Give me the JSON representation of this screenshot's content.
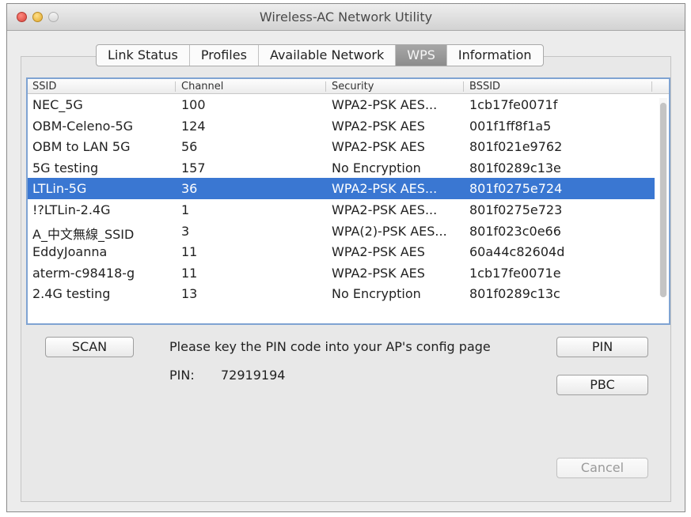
{
  "window": {
    "title": "Wireless-AC Network Utility"
  },
  "tabs": [
    {
      "label": "Link Status",
      "active": false
    },
    {
      "label": "Profiles",
      "active": false
    },
    {
      "label": "Available Network",
      "active": false
    },
    {
      "label": "WPS",
      "active": true
    },
    {
      "label": "Information",
      "active": false
    }
  ],
  "network_list": {
    "columns": [
      "SSID",
      "Channel",
      "Security",
      "BSSID"
    ],
    "rows": [
      {
        "ssid": "NEC_5G",
        "channel": "100",
        "security": "WPA2-PSK AES...",
        "bssid": "1cb17fe0071f"
      },
      {
        "ssid": "OBM-Celeno-5G",
        "channel": "124",
        "security": "WPA2-PSK AES",
        "bssid": "001f1ff8f1a5"
      },
      {
        "ssid": "OBM to LAN 5G",
        "channel": "56",
        "security": "WPA2-PSK AES",
        "bssid": "801f021e9762"
      },
      {
        "ssid": "5G testing",
        "channel": "157",
        "security": "No Encryption",
        "bssid": "801f0289c13e"
      },
      {
        "ssid": "LTLin-5G",
        "channel": "36",
        "security": "WPA2-PSK AES...",
        "bssid": "801f0275e724",
        "selected": true
      },
      {
        "ssid": "!?LTLin-2.4G",
        "channel": "1",
        "security": "WPA2-PSK AES...",
        "bssid": "801f0275e723"
      },
      {
        "ssid": "A_中文無線_SSID",
        "channel": "3",
        "security": "WPA(2)-PSK AES...",
        "bssid": "801f023c0e66"
      },
      {
        "ssid": "EddyJoanna",
        "channel": "11",
        "security": "WPA2-PSK AES",
        "bssid": "60a44c82604d"
      },
      {
        "ssid": "aterm-c98418-g",
        "channel": "11",
        "security": "WPA2-PSK AES",
        "bssid": "1cb17fe0071e"
      },
      {
        "ssid": "2.4G testing",
        "channel": "13",
        "security": "No Encryption",
        "bssid": "801f0289c13c"
      }
    ]
  },
  "wps": {
    "scan_label": "SCAN",
    "instruction": "Please key the PIN code into your AP's config page",
    "pin_label": "PIN:",
    "pin_value": "72919194",
    "pin_button": "PIN",
    "pbc_button": "PBC",
    "cancel_button": "Cancel"
  },
  "colors": {
    "selection": "#3a77d2",
    "focus_ring": "#7fa3d2"
  }
}
